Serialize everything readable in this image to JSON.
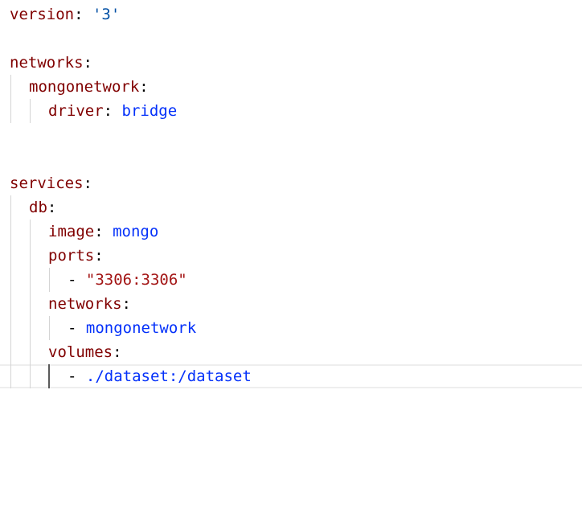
{
  "editor": {
    "lines": {
      "version_key": "version",
      "version_value": "'3'",
      "networks_key": "networks",
      "mongonetwork_key": "mongonetwork",
      "driver_key": "driver",
      "driver_value": "bridge",
      "services_key": "services",
      "db_key": "db",
      "image_key": "image",
      "image_value": "mongo",
      "ports_key": "ports",
      "ports_item": "\"3306:3306\"",
      "db_networks_key": "networks",
      "db_networks_item": "mongonetwork",
      "volumes_key": "volumes",
      "volumes_item": "./dataset:/dataset"
    },
    "colon": ":",
    "dash": "-"
  }
}
